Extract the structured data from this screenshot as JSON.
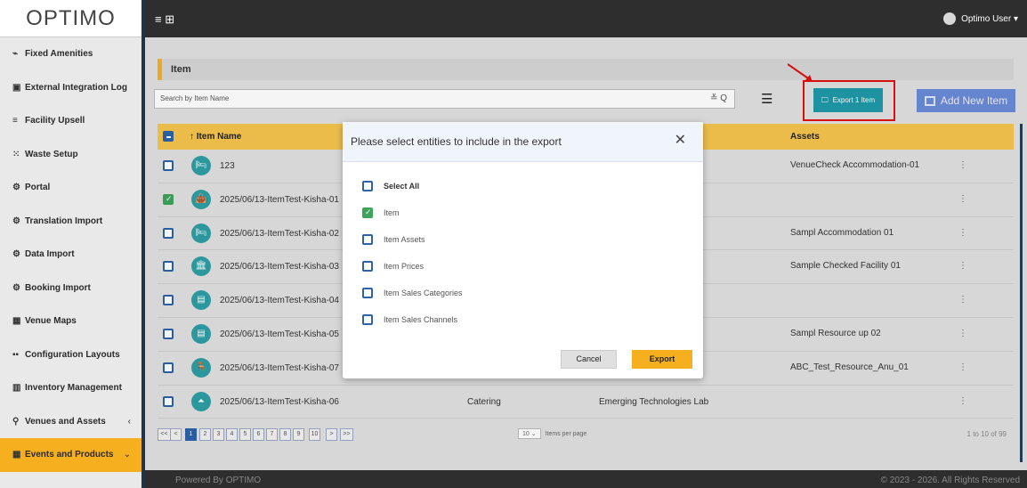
{
  "brand": {
    "logo_text": "OPTIMO"
  },
  "sidebar": {
    "items": [
      {
        "label": "Fixed Amenities",
        "icon": "rss-icon"
      },
      {
        "label": "External Integration Log",
        "icon": "file-icon"
      },
      {
        "label": "Facility Upsell",
        "icon": "list-icon"
      },
      {
        "label": "Waste Setup",
        "icon": "grid-icon"
      },
      {
        "label": "Portal",
        "icon": "cogs-icon"
      },
      {
        "label": "Translation Import",
        "icon": "cogs-icon"
      },
      {
        "label": "Data Import",
        "icon": "cogs-icon"
      },
      {
        "label": "Booking Import",
        "icon": "cogs-icon"
      },
      {
        "label": "Venue Maps",
        "icon": "map-icon"
      },
      {
        "label": "Configuration Layouts",
        "icon": "th-icon"
      },
      {
        "label": "Inventory Management",
        "icon": "building-icon"
      },
      {
        "label": "Venues and Assets",
        "icon": "marker-icon",
        "chevron": "‹"
      },
      {
        "label": "Events and Products",
        "icon": "calendar-icon",
        "chevron": "⌄",
        "active": true
      }
    ]
  },
  "topbar": {
    "menu_glyph": "≡ ⊞",
    "user_name": "Optimo User ▾"
  },
  "page": {
    "title": "Item"
  },
  "search": {
    "placeholder": "Search by Item Name",
    "icons": "≚ Q"
  },
  "toolbar": {
    "export_label": "Export 1 Item",
    "add_label": "Add New Item"
  },
  "table": {
    "headers": {
      "name": "↑  Item Name",
      "assets": "Assets"
    },
    "rows": [
      {
        "name": "123",
        "category": "",
        "location": "",
        "assets": "VenueCheck Accommodation-01",
        "checked": false,
        "icon": "🛏"
      },
      {
        "name": "2025/06/13-ItemTest-Kisha-01",
        "category": "",
        "location": "",
        "assets": "",
        "checked": true,
        "icon": "👜"
      },
      {
        "name": "2025/06/13-ItemTest-Kisha-02",
        "category": "",
        "location": "",
        "assets": "Sampl Accommodation 01",
        "checked": false,
        "icon": "🛏"
      },
      {
        "name": "2025/06/13-ItemTest-Kisha-03",
        "category": "",
        "location": "",
        "assets": "Sample Checked Facility 01",
        "checked": false,
        "icon": "🏛"
      },
      {
        "name": "2025/06/13-ItemTest-Kisha-04",
        "category": "",
        "location": "",
        "assets": "",
        "checked": false,
        "icon": "▤"
      },
      {
        "name": "2025/06/13-ItemTest-Kisha-05",
        "category": "",
        "location": "",
        "assets": "Sampl Resource up 02",
        "checked": false,
        "icon": "▤"
      },
      {
        "name": "2025/06/13-ItemTest-Kisha-07",
        "category": "",
        "location": "",
        "assets": "ABC_Test_Resource_Anu_01",
        "checked": false,
        "icon": "🪑"
      },
      {
        "name": "2025/06/13-ItemTest-Kisha-06",
        "category": "Catering",
        "location": "Emerging Technologies Lab",
        "assets": "",
        "checked": false,
        "icon": "⏶"
      }
    ],
    "more_glyph": "⋮"
  },
  "pager": {
    "buttons": [
      "<<",
      "<",
      "1",
      "2",
      "3",
      "4",
      "5",
      "6",
      "7",
      "8",
      "9",
      "10",
      ">",
      ">>"
    ],
    "active": "1",
    "per_page": "10",
    "per_page_label": "Items per page",
    "count": "1 to 10 of 99"
  },
  "modal": {
    "title": "Please select entities to include in the export",
    "close": "✕",
    "options": [
      {
        "label": "Select All",
        "checked": false,
        "bold": true
      },
      {
        "label": "Item",
        "checked": true,
        "bold": false
      },
      {
        "label": "Item Assets",
        "checked": false,
        "bold": false
      },
      {
        "label": "Item Prices",
        "checked": false,
        "bold": false
      },
      {
        "label": "Item Sales Categories",
        "checked": false,
        "bold": false
      },
      {
        "label": "Item Sales Channels",
        "checked": false,
        "bold": false
      }
    ],
    "cancel_label": "Cancel",
    "export_label": "Export"
  },
  "footer": {
    "powered_by": "Powered By OPTIMO",
    "copyright": "© 2023 - 2026. All Rights Reserved"
  },
  "colors": {
    "accent": "#f6b01f",
    "teal": "#1f9aa8",
    "blue": "#6b8bd8",
    "highlight": "#e01010"
  }
}
